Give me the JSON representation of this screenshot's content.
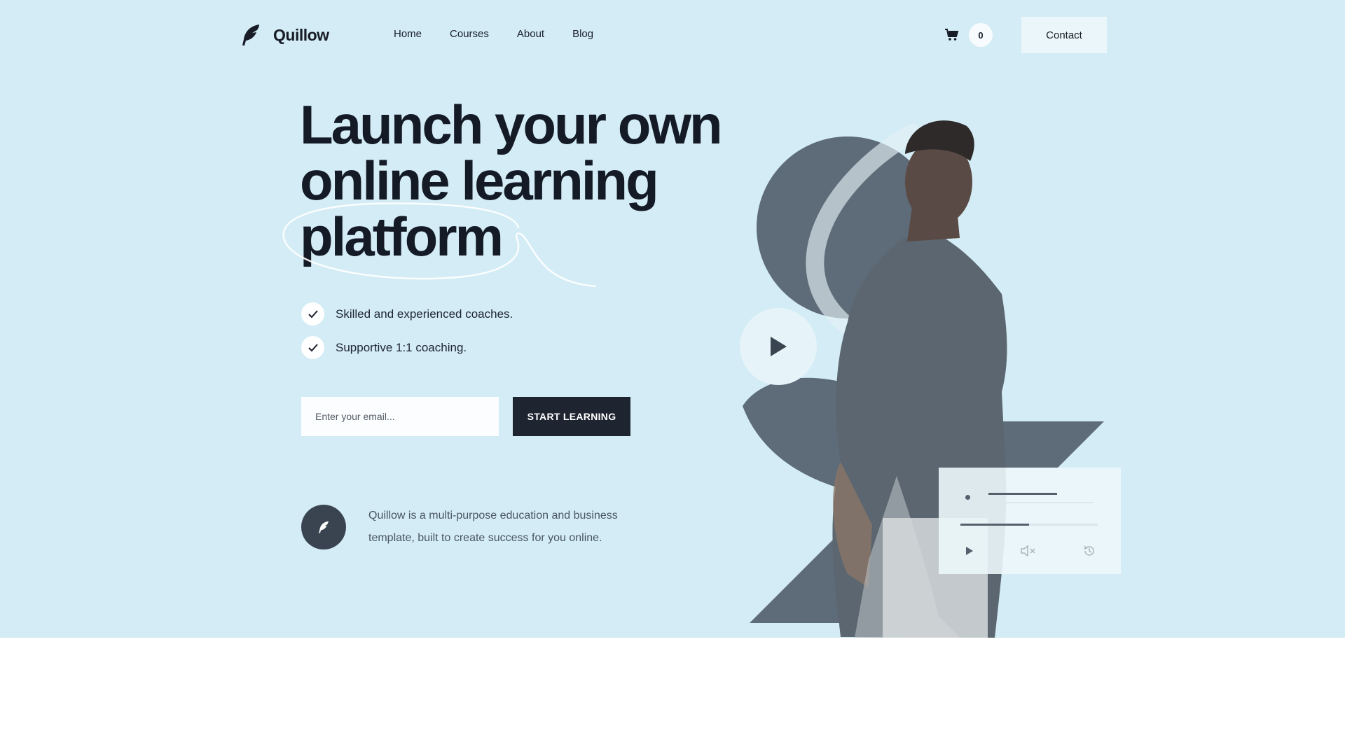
{
  "brand": {
    "name": "Quillow",
    "logo_icon": "feather-icon"
  },
  "nav": {
    "items": [
      {
        "label": "Home"
      },
      {
        "label": "Courses"
      },
      {
        "label": "About"
      },
      {
        "label": "Blog"
      }
    ]
  },
  "cart": {
    "icon": "cart-icon",
    "count": "0"
  },
  "header": {
    "contact_label": "Contact"
  },
  "hero": {
    "headline_line1": "Launch your own",
    "headline_line2": "online learning",
    "headline_line3": "platform",
    "features": [
      {
        "text": "Skilled and experienced coaches."
      },
      {
        "text": "Supportive 1:1 coaching."
      }
    ],
    "email_placeholder": "Enter your email...",
    "cta_label": "START LEARNING",
    "about_text": "Quillow is a multi-purpose education and business template, built to create success for you online."
  },
  "player": {
    "icons": [
      "play-icon",
      "mute-icon",
      "replay-icon"
    ],
    "progress": 0.5
  },
  "colors": {
    "hero_bg": "#d3ecf5",
    "dark": "#1f2530",
    "shape": "#5e6b78",
    "white": "#ffffff"
  }
}
